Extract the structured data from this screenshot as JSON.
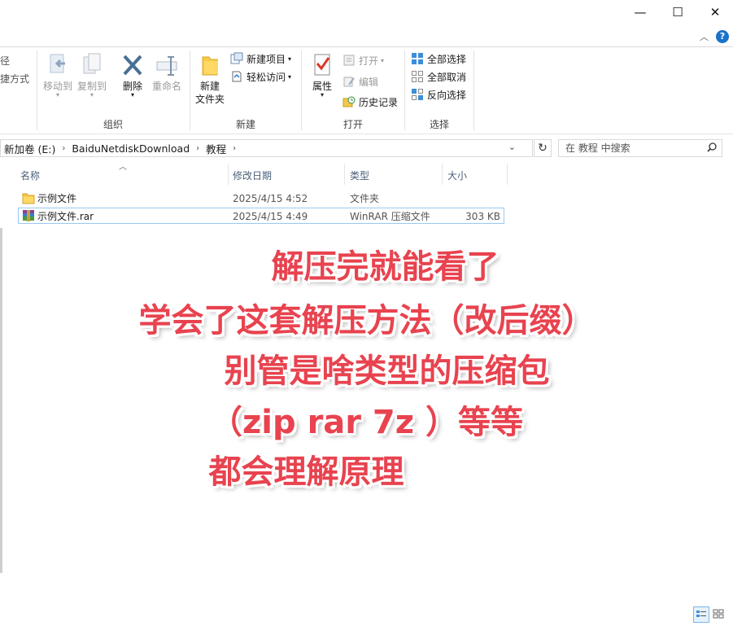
{
  "window": {
    "minimize": "—",
    "maximize": "☐",
    "close": "✕"
  },
  "ribbon": {
    "clipboard_partial": {
      "line1": "径",
      "line2": "捷方式"
    },
    "organize": {
      "label": "组织",
      "move_to": "移动到",
      "copy_to": "复制到",
      "delete": "删除",
      "rename": "重命名"
    },
    "new": {
      "label": "新建",
      "new_folder_line1": "新建",
      "new_folder_line2": "文件夹",
      "new_item": "新建项目",
      "easy_access": "轻松访问"
    },
    "open": {
      "label": "打开",
      "properties": "属性",
      "open": "打开",
      "edit": "编辑",
      "history": "历史记录"
    },
    "select": {
      "label": "选择",
      "select_all": "全部选择",
      "select_none": "全部取消",
      "invert": "反向选择"
    }
  },
  "address": {
    "crumbs": [
      "新加卷 (E:)",
      "BaiduNetdiskDownload",
      "教程"
    ]
  },
  "search": {
    "placeholder": "在 教程 中搜索"
  },
  "columns": {
    "name": "名称",
    "modified": "修改日期",
    "type": "类型",
    "size": "大小"
  },
  "files": [
    {
      "name": "示例文件",
      "modified": "2025/4/15 4:52",
      "type": "文件夹",
      "size": "",
      "icon": "folder-icon"
    },
    {
      "name": "示例文件.rar",
      "modified": "2025/4/15 4:49",
      "type": "WinRAR 压缩文件",
      "size": "303 KB",
      "icon": "rar-icon"
    }
  ],
  "overlay": {
    "line1": "解压完就能看了",
    "line2": "学会了这套解压方法（改后缀）",
    "line3": "别管是啥类型的压缩包",
    "line4": "（zip rar 7z ）等等",
    "line5": "都会理解原理"
  },
  "colors": {
    "overlay_text": "#e8434f",
    "accent": "#1a73c8",
    "selection_border": "#99c9ef"
  }
}
